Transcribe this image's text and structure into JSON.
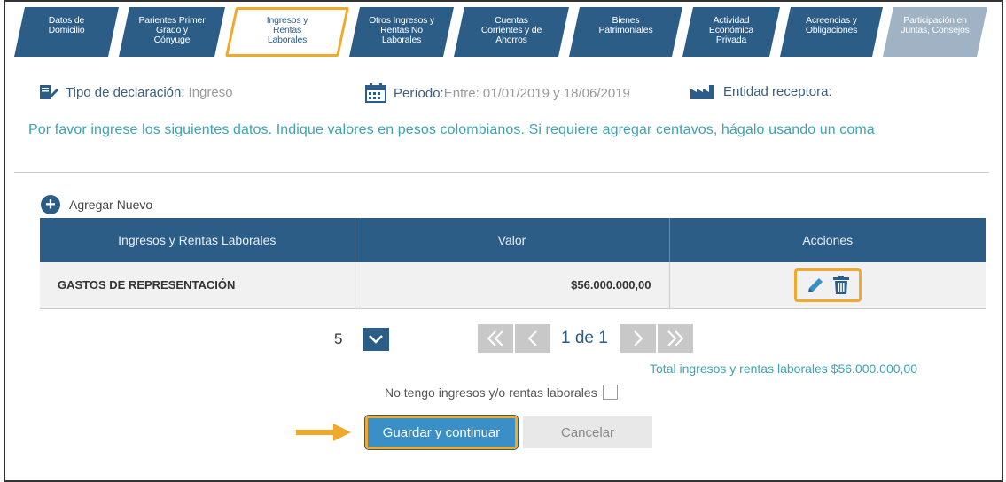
{
  "tabs": [
    {
      "label": "Datos de\nDomicilio"
    },
    {
      "label": "Parientes Primer\nGrado y\nCónyuge"
    },
    {
      "label": "Ingresos y\nRentas\nLaborales"
    },
    {
      "label": "Otros Ingresos y\nRentas No\nLaborales"
    },
    {
      "label": "Cuentas\nCorrientes y de\nAhorros"
    },
    {
      "label": "Bienes\nPatrimoniales"
    },
    {
      "label": "Actividad\nEconómica\nPrivada"
    },
    {
      "label": "Acreencias y\nObligaciones"
    },
    {
      "label": "Participación en\nJuntas, Consejos"
    }
  ],
  "info": {
    "tipo_label": "Tipo de declaración:",
    "tipo_value": "Ingreso",
    "periodo_label": "Período:",
    "periodo_value": "Entre: 01/01/2019 y 18/06/2019",
    "entidad_label": "Entidad receptora:"
  },
  "instructions": "Por favor ingrese los siguientes datos. Indique valores en pesos colombianos. Si requiere agregar centavos, hágalo usando un coma",
  "add_new": "Agregar Nuevo",
  "table": {
    "headers": [
      "Ingresos y Rentas Laborales",
      "Valor",
      "Acciones"
    ],
    "rows": [
      {
        "concepto": "GASTOS DE REPRESENTACIÓN",
        "valor": "$56.000.000,00"
      }
    ]
  },
  "pager": {
    "page_size": "5",
    "page_text": "1 de 1"
  },
  "total": "Total ingresos y rentas laborales $56.000.000,00",
  "no_income_label": "No tengo ingresos y/o rentas laborales",
  "buttons": {
    "save": "Guardar y continuar",
    "cancel": "Cancelar"
  },
  "colors": {
    "primary": "#2c5d87",
    "highlight": "#f0a92a",
    "accent_text": "#3ba3b5",
    "save_button": "#3a8fc6"
  },
  "icons": [
    "edit-icon",
    "signature-icon",
    "calendar-icon",
    "factory-icon",
    "plus-icon",
    "pencil-icon",
    "trash-icon",
    "chevron-down-icon",
    "double-left-icon",
    "left-icon",
    "right-icon",
    "double-right-icon",
    "arrow-icon"
  ]
}
